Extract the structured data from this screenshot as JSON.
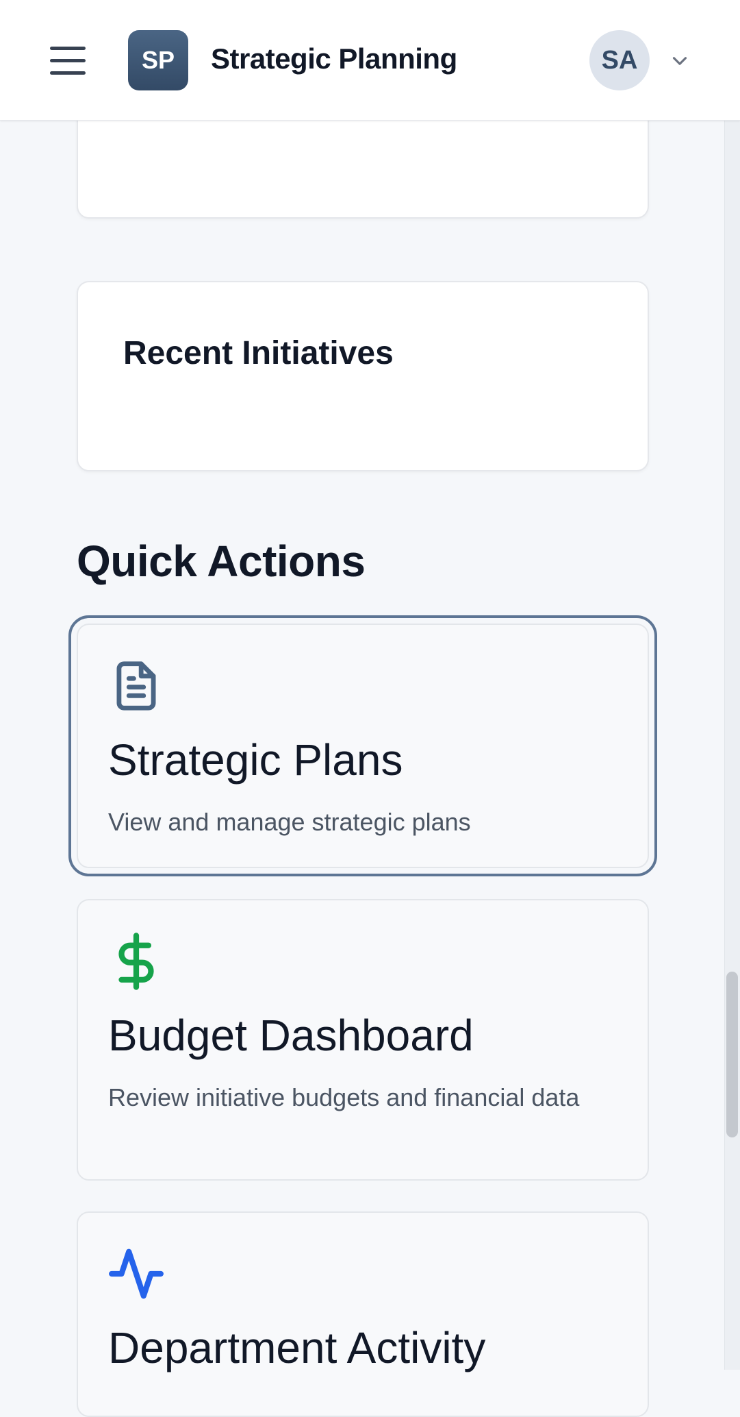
{
  "header": {
    "menu_icon": "hamburger-menu-icon",
    "logo_text": "SP",
    "app_title": "Strategic Planning",
    "avatar_initials": "SA",
    "dropdown_icon": "chevron-down-icon"
  },
  "main": {
    "recent_initiatives_title": "Recent Initiatives",
    "quick_actions_title": "Quick Actions",
    "quick_actions": [
      {
        "icon": "document-icon",
        "icon_color": "#4a6584",
        "title": "Strategic Plans",
        "description": "View and manage strategic plans"
      },
      {
        "icon": "dollar-icon",
        "icon_color": "#16a34a",
        "title": "Budget Dashboard",
        "description": "Review initiative budgets and financial data"
      },
      {
        "icon": "activity-icon",
        "icon_color": "#2563eb",
        "title": "Department Activity",
        "description": ""
      }
    ]
  },
  "colors": {
    "background": "#f5f7fa",
    "brand": "#4a6584",
    "focus_ring": "#5d7594"
  }
}
